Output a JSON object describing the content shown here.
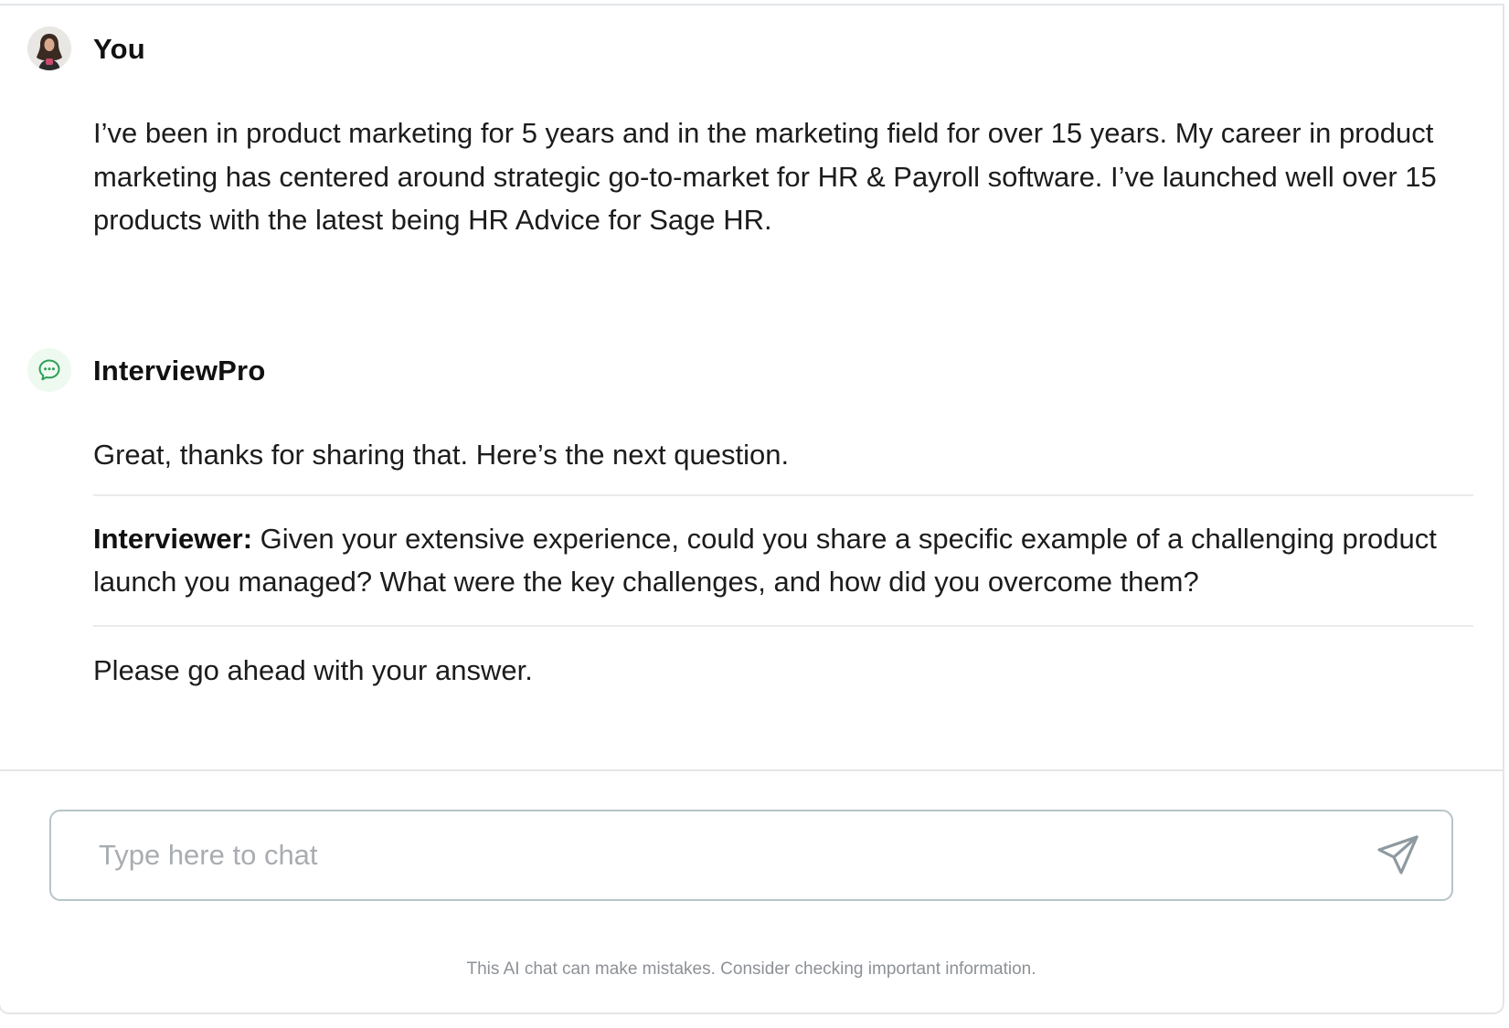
{
  "conversation": {
    "user_message": {
      "sender": "You",
      "text": "I’ve been in product marketing for 5 years and in the marketing field for over 15 years. My career in product marketing has centered around strategic go-to-market for HR & Payroll software. I’ve launched well over 15 products with the latest being HR Advice for Sage HR.",
      "avatar_icon": "user-photo-avatar"
    },
    "bot_message": {
      "sender": "InterviewPro",
      "avatar_icon": "chat-bubble-icon",
      "intro": "Great, thanks for sharing that. Here’s the next question.",
      "question_label": "Interviewer:",
      "question_text": " Given your extensive experience, could you share a specific example of a challenging product launch you managed? What were the key challenges, and how did you overcome them?",
      "closing": "Please go ahead with your answer."
    }
  },
  "composer": {
    "placeholder": "Type here to chat",
    "value": "",
    "send_icon": "paper-plane-icon"
  },
  "disclaimer": "This AI chat can make mistakes. Consider checking important information.",
  "colors": {
    "bot_accent": "#2e9e57",
    "input_border": "#b7c4c8",
    "divider": "#e9ebed"
  }
}
